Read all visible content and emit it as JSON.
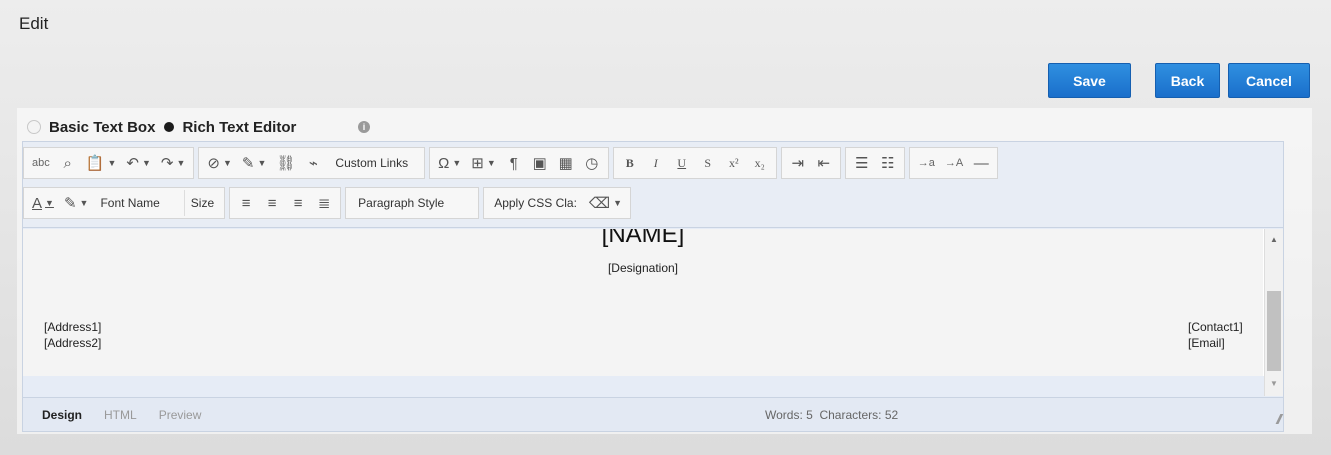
{
  "page": {
    "title": "Edit"
  },
  "actions": {
    "save": "Save",
    "back": "Back",
    "cancel": "Cancel"
  },
  "modes": {
    "basic": "Basic Text Box",
    "rich": "Rich Text Editor",
    "selected": "rich"
  },
  "toolbar": {
    "custom_links": "Custom Links",
    "font_name": "Font Name",
    "size": "Size",
    "paragraph_style": "Paragraph Style",
    "apply_css": "Apply CSS Cla:",
    "bold": "B",
    "italic": "I",
    "underline": "U",
    "strikethrough": "S",
    "superscript": "x²",
    "subscript": "x₂",
    "spell_abc": "abc",
    "ltr": "→a",
    "rtl": "→A"
  },
  "document": {
    "name": "[NAME]",
    "designation": "[Designation]",
    "address1": "[Address1]",
    "address2": "[Address2]",
    "contact1": "[Contact1]",
    "email": "[Email]"
  },
  "footer": {
    "tabs": [
      "Design",
      "HTML",
      "Preview"
    ],
    "active_tab": "Design",
    "words_label": "Words: 5",
    "characters_label": "Characters: 52"
  },
  "colors": {
    "accent": "#1a6fcb",
    "toolbar_bg": "#e8edf5"
  }
}
